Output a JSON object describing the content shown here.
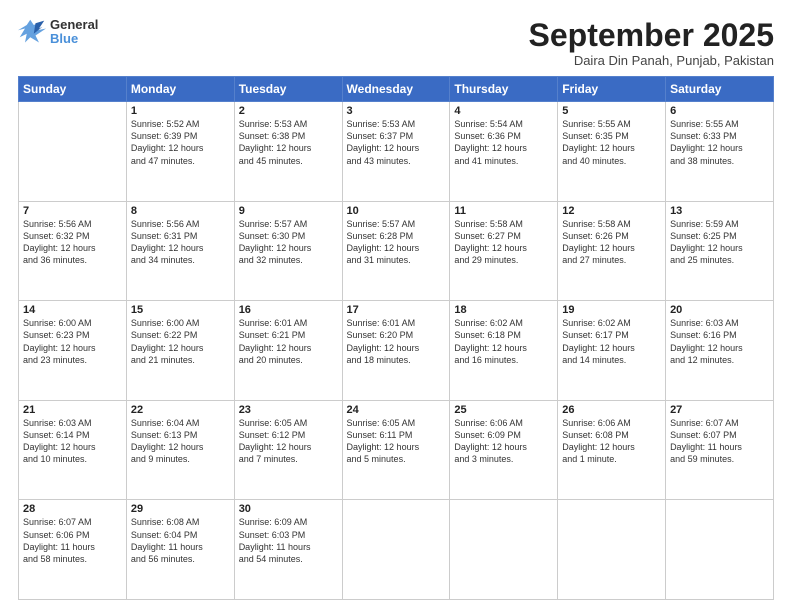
{
  "logo": {
    "line1": "General",
    "line2": "Blue"
  },
  "header": {
    "title": "September 2025",
    "location": "Daira Din Panah, Punjab, Pakistan"
  },
  "weekdays": [
    "Sunday",
    "Monday",
    "Tuesday",
    "Wednesday",
    "Thursday",
    "Friday",
    "Saturday"
  ],
  "weeks": [
    [
      {
        "day": "",
        "info": ""
      },
      {
        "day": "1",
        "info": "Sunrise: 5:52 AM\nSunset: 6:39 PM\nDaylight: 12 hours\nand 47 minutes."
      },
      {
        "day": "2",
        "info": "Sunrise: 5:53 AM\nSunset: 6:38 PM\nDaylight: 12 hours\nand 45 minutes."
      },
      {
        "day": "3",
        "info": "Sunrise: 5:53 AM\nSunset: 6:37 PM\nDaylight: 12 hours\nand 43 minutes."
      },
      {
        "day": "4",
        "info": "Sunrise: 5:54 AM\nSunset: 6:36 PM\nDaylight: 12 hours\nand 41 minutes."
      },
      {
        "day": "5",
        "info": "Sunrise: 5:55 AM\nSunset: 6:35 PM\nDaylight: 12 hours\nand 40 minutes."
      },
      {
        "day": "6",
        "info": "Sunrise: 5:55 AM\nSunset: 6:33 PM\nDaylight: 12 hours\nand 38 minutes."
      }
    ],
    [
      {
        "day": "7",
        "info": "Sunrise: 5:56 AM\nSunset: 6:32 PM\nDaylight: 12 hours\nand 36 minutes."
      },
      {
        "day": "8",
        "info": "Sunrise: 5:56 AM\nSunset: 6:31 PM\nDaylight: 12 hours\nand 34 minutes."
      },
      {
        "day": "9",
        "info": "Sunrise: 5:57 AM\nSunset: 6:30 PM\nDaylight: 12 hours\nand 32 minutes."
      },
      {
        "day": "10",
        "info": "Sunrise: 5:57 AM\nSunset: 6:28 PM\nDaylight: 12 hours\nand 31 minutes."
      },
      {
        "day": "11",
        "info": "Sunrise: 5:58 AM\nSunset: 6:27 PM\nDaylight: 12 hours\nand 29 minutes."
      },
      {
        "day": "12",
        "info": "Sunrise: 5:58 AM\nSunset: 6:26 PM\nDaylight: 12 hours\nand 27 minutes."
      },
      {
        "day": "13",
        "info": "Sunrise: 5:59 AM\nSunset: 6:25 PM\nDaylight: 12 hours\nand 25 minutes."
      }
    ],
    [
      {
        "day": "14",
        "info": "Sunrise: 6:00 AM\nSunset: 6:23 PM\nDaylight: 12 hours\nand 23 minutes."
      },
      {
        "day": "15",
        "info": "Sunrise: 6:00 AM\nSunset: 6:22 PM\nDaylight: 12 hours\nand 21 minutes."
      },
      {
        "day": "16",
        "info": "Sunrise: 6:01 AM\nSunset: 6:21 PM\nDaylight: 12 hours\nand 20 minutes."
      },
      {
        "day": "17",
        "info": "Sunrise: 6:01 AM\nSunset: 6:20 PM\nDaylight: 12 hours\nand 18 minutes."
      },
      {
        "day": "18",
        "info": "Sunrise: 6:02 AM\nSunset: 6:18 PM\nDaylight: 12 hours\nand 16 minutes."
      },
      {
        "day": "19",
        "info": "Sunrise: 6:02 AM\nSunset: 6:17 PM\nDaylight: 12 hours\nand 14 minutes."
      },
      {
        "day": "20",
        "info": "Sunrise: 6:03 AM\nSunset: 6:16 PM\nDaylight: 12 hours\nand 12 minutes."
      }
    ],
    [
      {
        "day": "21",
        "info": "Sunrise: 6:03 AM\nSunset: 6:14 PM\nDaylight: 12 hours\nand 10 minutes."
      },
      {
        "day": "22",
        "info": "Sunrise: 6:04 AM\nSunset: 6:13 PM\nDaylight: 12 hours\nand 9 minutes."
      },
      {
        "day": "23",
        "info": "Sunrise: 6:05 AM\nSunset: 6:12 PM\nDaylight: 12 hours\nand 7 minutes."
      },
      {
        "day": "24",
        "info": "Sunrise: 6:05 AM\nSunset: 6:11 PM\nDaylight: 12 hours\nand 5 minutes."
      },
      {
        "day": "25",
        "info": "Sunrise: 6:06 AM\nSunset: 6:09 PM\nDaylight: 12 hours\nand 3 minutes."
      },
      {
        "day": "26",
        "info": "Sunrise: 6:06 AM\nSunset: 6:08 PM\nDaylight: 12 hours\nand 1 minute."
      },
      {
        "day": "27",
        "info": "Sunrise: 6:07 AM\nSunset: 6:07 PM\nDaylight: 11 hours\nand 59 minutes."
      }
    ],
    [
      {
        "day": "28",
        "info": "Sunrise: 6:07 AM\nSunset: 6:06 PM\nDaylight: 11 hours\nand 58 minutes."
      },
      {
        "day": "29",
        "info": "Sunrise: 6:08 AM\nSunset: 6:04 PM\nDaylight: 11 hours\nand 56 minutes."
      },
      {
        "day": "30",
        "info": "Sunrise: 6:09 AM\nSunset: 6:03 PM\nDaylight: 11 hours\nand 54 minutes."
      },
      {
        "day": "",
        "info": ""
      },
      {
        "day": "",
        "info": ""
      },
      {
        "day": "",
        "info": ""
      },
      {
        "day": "",
        "info": ""
      }
    ]
  ]
}
